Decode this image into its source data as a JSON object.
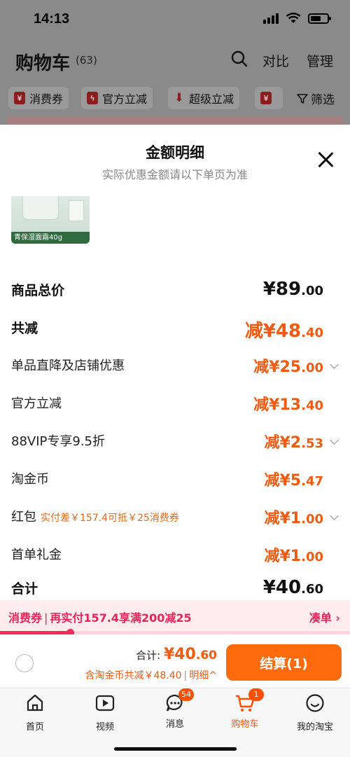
{
  "status": {
    "time": "14:13"
  },
  "background": {
    "title": "购物车",
    "count": "(63)",
    "compare": "对比",
    "manage": "管理",
    "chips": [
      {
        "icon": "coupon-icon",
        "label": "消费券"
      },
      {
        "icon": "bolt-icon",
        "label": "官方立减"
      },
      {
        "icon": "down-arrow-icon",
        "label": "超级立减"
      }
    ],
    "filter": "筛选"
  },
  "sheet": {
    "title": "金额明细",
    "subtitle": "实际优惠金额请以下单页为准",
    "product_caption": "青保湿面霜40g",
    "rows": [
      {
        "label": "商品总价",
        "value_main": "¥89",
        "value_dec": ".00",
        "bold": true
      },
      {
        "label": "共减",
        "value_main": "减¥48",
        "value_dec": ".40",
        "bold": true
      },
      {
        "label": "单品直降及店铺优惠",
        "value_main": "减¥25",
        "value_dec": ".00"
      },
      {
        "label": "官方立减",
        "value_main": "减¥13",
        "value_dec": ".40"
      },
      {
        "label": "88VIP专享9.5折",
        "value_main": "减¥2",
        "value_dec": ".53"
      },
      {
        "label": "淘金币",
        "value_main": "减¥5",
        "value_dec": ".47"
      },
      {
        "label": "红包",
        "note": "实付差￥157.4可抵￥25消费券",
        "value_main": "减¥1",
        "value_dec": ".00"
      },
      {
        "label": "首单礼金",
        "value_main": "减¥1",
        "value_dec": ".00"
      },
      {
        "label": "合计",
        "value_main": "¥40",
        "value_dec": ".60",
        "bold": true
      }
    ]
  },
  "coupon": {
    "tag": "消费券",
    "sep": "|",
    "message": "再实付157.4享满200减25",
    "action": "凑单 ›",
    "progress_percent": 20
  },
  "checkout": {
    "total_label": "合计: ",
    "total_main": "¥40",
    "total_dec": ".60",
    "discount_text": "含淘金币共减￥48.40",
    "detail_sep": "|",
    "detail_label": "明细^",
    "button_label": "结算(1)"
  },
  "tabs": [
    {
      "label": "首页",
      "icon": "home-icon"
    },
    {
      "label": "视频",
      "icon": "video-icon"
    },
    {
      "label": "消息",
      "icon": "message-icon",
      "badge": "54"
    },
    {
      "label": "购物车",
      "icon": "cart-icon",
      "badge": "1",
      "active": true
    },
    {
      "label": "我的淘宝",
      "icon": "profile-icon"
    }
  ],
  "colors": {
    "accent": "#ff5000",
    "coupon": "#e5265a",
    "discount": "#ef5b12"
  }
}
